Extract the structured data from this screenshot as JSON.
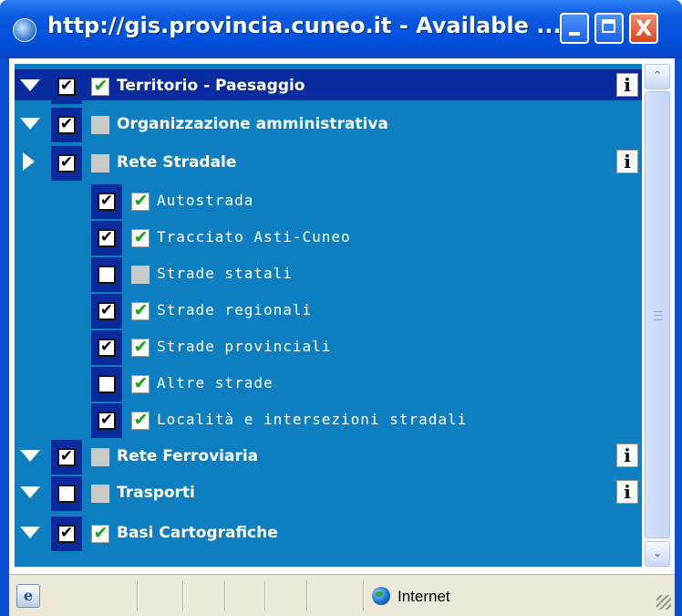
{
  "window": {
    "title": "http://gis.provincia.cuneo.it - Available ...",
    "minimize": "_",
    "maximize": "□",
    "close": "X"
  },
  "tree": {
    "rows": [
      {
        "label": "Territorio - Paesaggio",
        "level": 0,
        "expander": "down",
        "checked": true,
        "visible_checked": true,
        "info": true,
        "selected": true
      },
      {
        "label": "Organizzazione amministrativa",
        "level": 0,
        "expander": "down",
        "checked": true,
        "visible_checked": false,
        "info": false,
        "selected": false
      },
      {
        "label": "Rete Stradale",
        "level": 0,
        "expander": "right",
        "checked": true,
        "visible_checked": false,
        "info": true,
        "selected": false
      },
      {
        "label": "Autostrada",
        "level": 1,
        "checked": true,
        "visible_checked": true
      },
      {
        "label": "Tracciato Asti-Cuneo",
        "level": 1,
        "checked": true,
        "visible_checked": true
      },
      {
        "label": "Strade statali",
        "level": 1,
        "checked": false,
        "visible_checked": false
      },
      {
        "label": "Strade regionali",
        "level": 1,
        "checked": true,
        "visible_checked": true
      },
      {
        "label": "Strade provinciali",
        "level": 1,
        "checked": true,
        "visible_checked": true
      },
      {
        "label": "Altre strade",
        "level": 1,
        "checked": false,
        "visible_checked": true
      },
      {
        "label": "Località e intersezioni stradali",
        "level": 1,
        "checked": true,
        "visible_checked": true
      },
      {
        "label": "Rete Ferroviaria",
        "level": 0,
        "expander": "down",
        "checked": true,
        "visible_checked": false,
        "info": true,
        "selected": false
      },
      {
        "label": "Trasporti",
        "level": 0,
        "expander": "down",
        "checked": false,
        "visible_checked": false,
        "info": true,
        "selected": false
      },
      {
        "label": "Basi Cartografiche",
        "level": 0,
        "expander": "down",
        "checked": true,
        "visible_checked": true,
        "info": false,
        "selected": false
      }
    ],
    "info_glyph": "i",
    "check_glyph": "✔",
    "green_check_glyph": "✔"
  },
  "scrollbar": {
    "up": "⌃",
    "down": "⌄"
  },
  "status": {
    "icon": "e",
    "zone": "Internet"
  },
  "colors": {
    "tree_bg": "#0d7fc0",
    "selected_bg": "#0a2b9e",
    "title_bar": "#0050dc",
    "green_check": "#14a614"
  }
}
